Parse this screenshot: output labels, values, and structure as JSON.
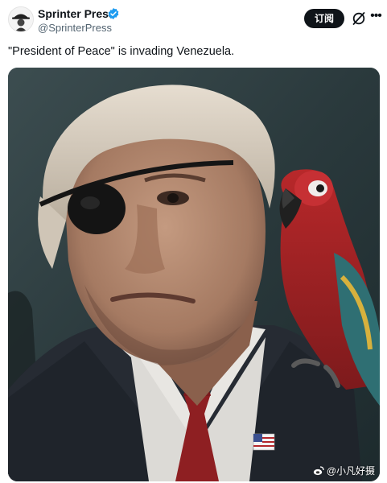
{
  "post": {
    "author": {
      "display_name": "Sprinter Press",
      "handle": "@SprinterPress",
      "verified": true,
      "avatar_icon": "hat-portrait-logo-icon"
    },
    "actions": {
      "subscribe_label": "订阅",
      "grok_icon": "grok-slash-icon",
      "more_icon": "more-dots-icon"
    },
    "text": "\"President of Peace\" is invading Venezuela.",
    "media": {
      "type": "image",
      "watermark": "@小凡好摄",
      "watermark_icon": "weibo-icon"
    }
  },
  "colors": {
    "text_primary": "#0f1419",
    "text_secondary": "#536471",
    "verified_blue": "#1d9bf0",
    "button_bg": "#0f1419"
  }
}
